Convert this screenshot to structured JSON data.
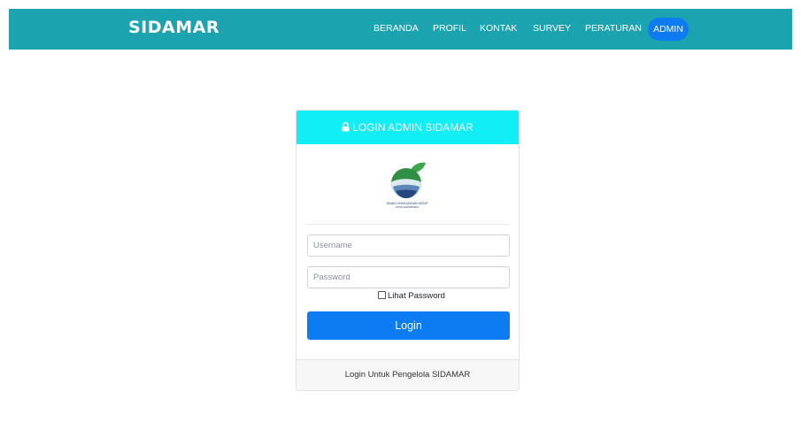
{
  "navbar": {
    "brand": "SIDAMAR",
    "links": [
      "BERANDA",
      "PROFIL",
      "KONTAK",
      "SURVEY",
      "PERATURAN"
    ],
    "admin": "ADMIN",
    "bg_color": "#1ca3b0",
    "active_color": "#0d7bf2"
  },
  "login": {
    "header": "LOGIN ADMIN SIDAMAR",
    "header_color": "#12eef5",
    "logo_icon": "dinas-lingkungan-hidup-logo",
    "logo_caption": "DINAS LINGKUNGAN HIDUP",
    "logo_subcaption": "KOTA SAMARINDA",
    "username_placeholder": "Username",
    "password_placeholder": "Password",
    "show_password": "Lihat Password",
    "button": "Login",
    "button_color": "#0d7bf2",
    "footer": "Login Untuk Pengelola SIDAMAR"
  }
}
